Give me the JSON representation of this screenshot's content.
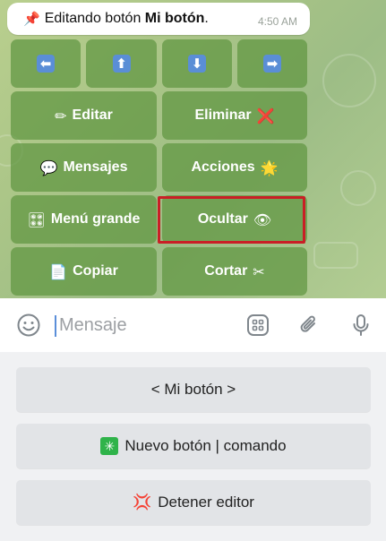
{
  "message": {
    "pin_icon": "pushpin-icon",
    "prefix": "Editando botón ",
    "bold_name": "Mi botón",
    "suffix": ".",
    "time": "4:50 AM"
  },
  "inline_keyboard": {
    "arrows": [
      {
        "icon": "arrow-left-icon",
        "glyph": "⬅"
      },
      {
        "icon": "arrow-up-icon",
        "glyph": "⬆"
      },
      {
        "icon": "arrow-down-icon",
        "glyph": "⬇"
      },
      {
        "icon": "arrow-right-icon",
        "glyph": "➡"
      }
    ],
    "edit": {
      "icon": "pencil-icon",
      "glyph": "✏",
      "label": "Editar"
    },
    "delete": {
      "label": "Eliminar",
      "icon": "cross-mark-icon",
      "glyph": "❌"
    },
    "messages": {
      "icon": "speech-bubble-icon",
      "glyph": "💬",
      "label": "Mensajes"
    },
    "actions": {
      "label": "Acciones",
      "icon": "glowing-star-icon",
      "glyph": "🌟"
    },
    "big_menu": {
      "icon": "control-knobs-icon",
      "glyph": "🎛",
      "label": "Menú grande"
    },
    "hide": {
      "label": "Ocultar",
      "icon": "eye-icon",
      "glyph": "👁"
    },
    "copy": {
      "icon": "page-icon",
      "glyph": "📄",
      "label": "Copiar"
    },
    "cut": {
      "label": "Cortar",
      "icon": "scissors-icon",
      "glyph": "✂"
    }
  },
  "input": {
    "placeholder": "Mensaje"
  },
  "reply_keyboard": {
    "my_button": {
      "label": "< Mi botón >"
    },
    "new_button": {
      "icon": "sparkle-icon",
      "glyph": "✳",
      "label": "Nuevo botón | comando"
    },
    "stop_editor": {
      "icon": "anger-symbol-icon",
      "glyph": "💢",
      "label": "Detener editor"
    }
  },
  "colors": {
    "inline_button": "#6a9a4e",
    "highlight_border": "#c91f26",
    "arrow_blue": "#5a8ed6",
    "reply_button": "#e2e4e7"
  }
}
